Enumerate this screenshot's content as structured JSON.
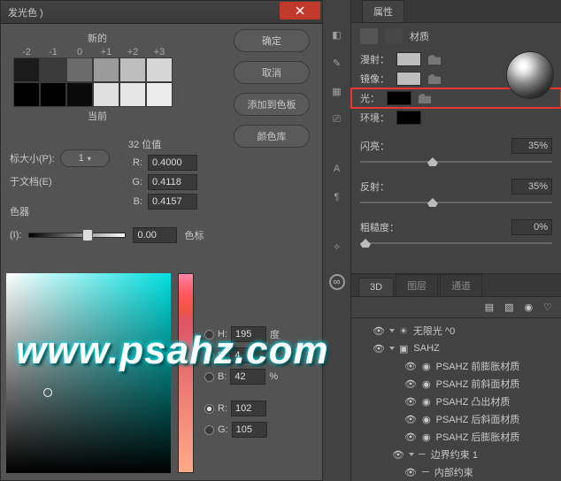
{
  "dialog": {
    "title": "发光色 )",
    "new_label": "新的",
    "current_label": "当前",
    "offsets": [
      "-2",
      "-1",
      "0",
      "+1",
      "+2",
      "+3"
    ],
    "swatch_top": [
      "#1b1b1b",
      "#3b3b3b",
      "#6b6b6b",
      "#9b9b9b",
      "#bdbdbd",
      "#d6d6d6"
    ],
    "swatch_bot": [
      "#000",
      "#000",
      "#0a0a0a",
      "#e0e0e0",
      "#e6e6e6",
      "#ececec"
    ],
    "buttons": {
      "ok": "确定",
      "cancel": "取消",
      "add": "添加到色板",
      "lib": "颜色库"
    },
    "bits_label": "32 位值",
    "rgb": {
      "r": "0.4000",
      "g": "0.4118",
      "b": "0.4157"
    },
    "size_label": "标大小(P):",
    "size_value": "1",
    "doc_label": "于文档(E)",
    "picker_label": "色器",
    "intensity_label": "(I):",
    "intensity_value": "0.00",
    "stop_label": "色标",
    "hsb": {
      "h": {
        "lbl": "H:",
        "val": "195",
        "unit": "度"
      },
      "s": {
        "lbl": "S:",
        "val": "4",
        "unit": "%"
      },
      "b": {
        "lbl": "B:",
        "val": "42",
        "unit": "%"
      },
      "r": {
        "lbl": "R:",
        "val": "102"
      },
      "g": {
        "lbl": "G:",
        "val": "105"
      }
    }
  },
  "props": {
    "tab": "属性",
    "header": "材质",
    "rows": {
      "diffuse": {
        "lbl": "漫射：",
        "color": "#bdbdbd"
      },
      "specular": {
        "lbl": "镜像：",
        "color": "#bdbdbd"
      },
      "glow": {
        "lbl": "光：",
        "color": "#000"
      },
      "ambient": {
        "lbl": "环境：",
        "color": "#000"
      }
    },
    "sliders": {
      "shine": {
        "lbl": "闪亮：",
        "val": "35%",
        "pos": "35%"
      },
      "reflect": {
        "lbl": "反射：",
        "val": "35%",
        "pos": "35%"
      },
      "rough": {
        "lbl": "粗糙度：",
        "val": "0%",
        "pos": "0%"
      }
    }
  },
  "lower": {
    "tabs": [
      "3D",
      "图层",
      "通道"
    ],
    "items": [
      {
        "name": "无限光 ^0",
        "ind": 1,
        "chev": "d",
        "ic": "sun"
      },
      {
        "name": "SAHZ",
        "ind": 1,
        "chev": "d",
        "ic": "mesh"
      },
      {
        "name": "PSAHZ 前膨胀材质",
        "ind": 3,
        "ic": "mat"
      },
      {
        "name": "PSAHZ 前斜面材质",
        "ind": 3,
        "ic": "mat"
      },
      {
        "name": "PSAHZ 凸出材质",
        "ind": 3,
        "ic": "mat"
      },
      {
        "name": "PSAHZ 后斜面材质",
        "ind": 3,
        "ic": "mat"
      },
      {
        "name": "PSAHZ 后膨胀材质",
        "ind": 3,
        "ic": "mat"
      },
      {
        "name": "边界约束 1",
        "ind": 2,
        "chev": "d",
        "ic": "line"
      },
      {
        "name": "内部约束",
        "ind": 3,
        "ic": "line"
      }
    ]
  },
  "watermark": "www.psahz.com"
}
